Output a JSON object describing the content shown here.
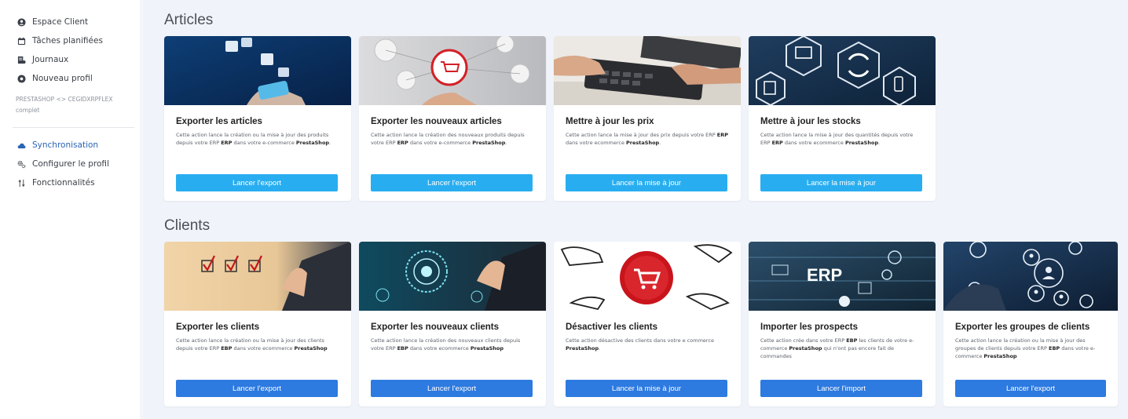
{
  "sidebar": {
    "items": [
      {
        "label": "Espace Client",
        "icon": "user-circle-icon"
      },
      {
        "label": "Tâches planifiées",
        "icon": "calendar-icon"
      },
      {
        "label": "Journaux",
        "icon": "journal-icon"
      },
      {
        "label": "Nouveau profil",
        "icon": "plus-circle-icon"
      }
    ],
    "group_label": "PRESTASHOP <> CEGIDXRPFLEX",
    "group_label_tail": "complet",
    "profile_items": [
      {
        "label": "Synchronisation",
        "icon": "cloud-sync-icon",
        "active": true
      },
      {
        "label": "Configurer le profil",
        "icon": "gears-icon",
        "active": false
      },
      {
        "label": "Fonctionnalités",
        "icon": "sort-arrows-icon",
        "active": false
      }
    ],
    "colors": {
      "active": "#2a64b4",
      "text": "#3b4048"
    }
  },
  "articles": {
    "title": "Articles",
    "cards": [
      {
        "title": "Exporter les articles",
        "desc_pre": "Cette action lance la création ou la mise à jour des produits depuis votre ERP ",
        "desc_bold1": "ERP",
        "desc_mid": " dans votre e-commerce ",
        "desc_bold2": "PrestaShop",
        "desc_post": ".",
        "button": "Lancer l'export",
        "image": "ecommerce-phone-image"
      },
      {
        "title": "Exporter les nouveaux articles",
        "desc_pre": "Cette action lance la création des nouveaux produits depuis votre ERP ",
        "desc_bold1": "ERP",
        "desc_mid": " dans votre e-commerce ",
        "desc_bold2": "PrestaShop",
        "desc_post": ".",
        "button": "Lancer l'export",
        "image": "shopping-cart-network-image"
      },
      {
        "title": "Mettre à jour les prix",
        "desc_pre": "Cette action lance la mise à jour des prix depuis votre ERP ",
        "desc_bold1": "ERP",
        "desc_mid": " dans votre ecommerce ",
        "desc_bold2": "PrestaShop",
        "desc_post": ".",
        "button": "Lancer la mise à jour",
        "image": "calculator-image"
      },
      {
        "title": "Mettre à jour les stocks",
        "desc_pre": "Cette action lance la mise à jour des quantités depuis votre ERP ",
        "desc_bold1": "ERP",
        "desc_mid": " dans votre ecommerce ",
        "desc_bold2": "PrestaShop",
        "desc_post": ".",
        "button": "Lancer la mise à jour",
        "image": "sync-hexagons-image"
      }
    ]
  },
  "clients": {
    "title": "Clients",
    "cards": [
      {
        "title": "Exporter les clients",
        "desc_pre": "Cette action lance la création ou la mise à jour des clients depuis votre ERP ",
        "desc_bold1": "EBP",
        "desc_mid": " dans votre ecommerce ",
        "desc_bold2": "PrestaShop",
        "desc_post": "",
        "button": "Lancer l'export",
        "image": "checkboxes-image"
      },
      {
        "title": "Exporter les nouveaux clients",
        "desc_pre": "Cette action lance la création des nouveaux clients depuis votre ERP ",
        "desc_bold1": "EBP",
        "desc_mid": " dans votre ecommerce ",
        "desc_bold2": "PrestaShop",
        "desc_post": "",
        "button": "Lancer l'export",
        "image": "digital-touch-image"
      },
      {
        "title": "Désactiver les clients",
        "desc_pre": "Cette action désactive des clients dans votre e commerce ",
        "desc_bold1": "PrestaShop",
        "desc_mid": ".",
        "desc_bold2": "",
        "desc_post": "",
        "button": "Lancer la mise à jour",
        "image": "red-cart-hands-image"
      },
      {
        "title": "Importer les prospects",
        "desc_pre": "Cette action crée dans votre ERP ",
        "desc_bold1": "EBP",
        "desc_mid": " les clients de votre e-commerce ",
        "desc_bold2": "PrestaShop",
        "desc_post": " qui n'ont pas encore fait de commandes",
        "button": "Lancer l'import",
        "image": "erp-dashboard-image",
        "image_text": "ERP"
      },
      {
        "title": "Exporter les groupes de clients",
        "desc_pre": "Cette action lance la création ou la mise à jour des groupes de clients depuis votre ERP ",
        "desc_bold1": "EBP",
        "desc_mid": " dans votre e-commerce ",
        "desc_bold2": "PrestaShop",
        "desc_post": "",
        "button": "Lancer l'export",
        "image": "user-network-image"
      }
    ]
  },
  "colors": {
    "button_light": "#28aef0",
    "button_dark": "#2d7ae0",
    "background": "#f0f4fa"
  }
}
